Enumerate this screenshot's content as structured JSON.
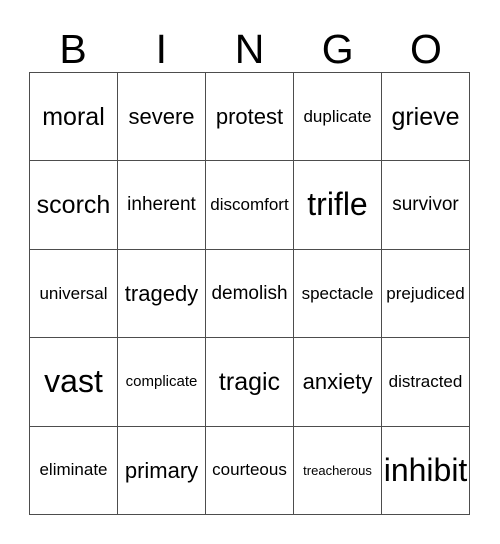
{
  "card": {
    "title": "BINGO",
    "header_letters": [
      "B",
      "I",
      "N",
      "G",
      "O"
    ],
    "grid_size": 5,
    "colors": {
      "background": "#ffffff",
      "text": "#000000",
      "border": "#4d4d4d"
    },
    "rows": [
      [
        {
          "label": "moral",
          "size": "xxl"
        },
        {
          "label": "severe",
          "size": "xl"
        },
        {
          "label": "protest",
          "size": "xl"
        },
        {
          "label": "duplicate",
          "size": "m"
        },
        {
          "label": "grieve",
          "size": "xxl"
        }
      ],
      [
        {
          "label": "scorch",
          "size": "xxl"
        },
        {
          "label": "inherent",
          "size": "l"
        },
        {
          "label": "discomfort",
          "size": "m"
        },
        {
          "label": "trifle",
          "size": "huge"
        },
        {
          "label": "survivor",
          "size": "l"
        }
      ],
      [
        {
          "label": "universal",
          "size": "m"
        },
        {
          "label": "tragedy",
          "size": "xl"
        },
        {
          "label": "demolish",
          "size": "l"
        },
        {
          "label": "spectacle",
          "size": "m"
        },
        {
          "label": "prejudiced",
          "size": "m"
        }
      ],
      [
        {
          "label": "vast",
          "size": "huge"
        },
        {
          "label": "complicate",
          "size": "s"
        },
        {
          "label": "tragic",
          "size": "xxl"
        },
        {
          "label": "anxiety",
          "size": "xl"
        },
        {
          "label": "distracted",
          "size": "m"
        }
      ],
      [
        {
          "label": "eliminate",
          "size": "m"
        },
        {
          "label": "primary",
          "size": "xl"
        },
        {
          "label": "courteous",
          "size": "m"
        },
        {
          "label": "treacherous",
          "size": "xs"
        },
        {
          "label": "inhibit",
          "size": "huge"
        }
      ]
    ]
  }
}
